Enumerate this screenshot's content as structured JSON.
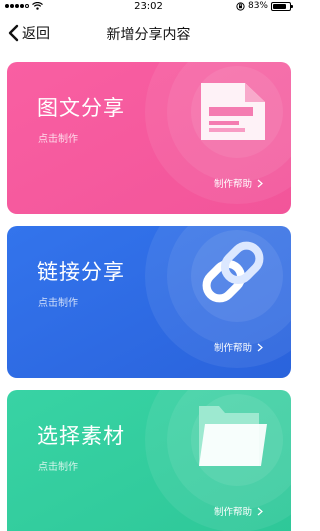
{
  "status_bar": {
    "time": "23:02",
    "battery_text": "83%",
    "battery_level": 0.83,
    "icons": [
      "signal-icon",
      "wifi-icon",
      "orientation-lock-icon",
      "battery-icon"
    ]
  },
  "nav": {
    "back_label": "返回",
    "back_icon": "chevron-left-icon",
    "title": "新增分享内容"
  },
  "cards": [
    {
      "title": "图文分享",
      "subtitle": "点击制作",
      "help": "制作帮助",
      "icon": "document-image-icon",
      "color": "#f85b9d"
    },
    {
      "title": "链接分享",
      "subtitle": "点击制作",
      "help": "制作帮助",
      "icon": "chain-link-icon",
      "color": "#2f6ce6"
    },
    {
      "title": "选择素材",
      "subtitle": "点击制作",
      "help": "制作帮助",
      "icon": "folder-icon",
      "color": "#33cf9f"
    }
  ]
}
